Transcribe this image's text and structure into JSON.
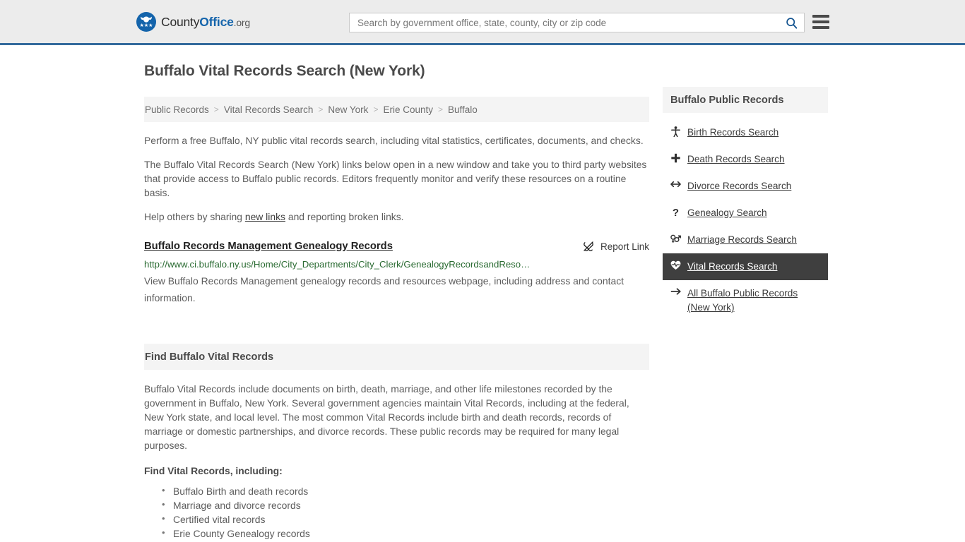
{
  "header": {
    "logo": {
      "part1": "County",
      "part2": "Office",
      "part3": ".org",
      "icon": "eagle-seal-icon"
    },
    "search": {
      "placeholder": "Search by government office, state, county, city or zip code",
      "value": "",
      "button_icon": "search-icon"
    },
    "menu_icon": "hamburger-menu-icon",
    "border_color": "#336a9c"
  },
  "main": {
    "title": "Buffalo Vital Records Search (New York)",
    "breadcrumb": {
      "separator": ">",
      "items": [
        "Public Records",
        "Vital Records Search",
        "New York",
        "Erie County",
        "Buffalo"
      ]
    },
    "paragraphs": [
      "Perform a free Buffalo, NY public vital records search, including vital statistics, certificates, documents, and checks.",
      "The Buffalo Vital Records Search (New York) links below open in a new window and take you to third party websites that provide access to Buffalo public records. Editors frequently monitor and verify these resources on a routine basis."
    ],
    "help_line": {
      "before": "Help others by sharing ",
      "link": "new links",
      "after": " and reporting broken links."
    },
    "result": {
      "title": "Buffalo Records Management Genealogy Records",
      "url": "http://www.ci.buffalo.ny.us/Home/City_Departments/City_Clerk/GenealogyRecordsandReso…",
      "url_color": "#2a6b32",
      "description": "View Buffalo Records Management genealogy records and resources webpage, including address and contact information.",
      "report": {
        "label": "Report Link",
        "icon": "broken-link-icon"
      }
    },
    "section": {
      "heading": "Find Buffalo Vital Records",
      "body": "Buffalo Vital Records include documents on birth, death, marriage, and other life milestones recorded by the government in Buffalo, New York. Several government agencies maintain Vital Records, including at the federal, New York state, and local level. The most common Vital Records include birth and death records, records of marriage or domestic partnerships, and divorce records. These public records may be required for many legal purposes.",
      "list_heading": "Find Vital Records, including:",
      "list": [
        "Buffalo Birth and death records",
        "Marriage and divorce records",
        "Certified vital records",
        "Erie County Genealogy records"
      ]
    }
  },
  "sidebar": {
    "heading": "Buffalo Public Records",
    "active_bg": "#3f3f3f",
    "items": [
      {
        "label": "Birth Records Search",
        "icon": "baby-icon",
        "glyph": "Ɣ",
        "active": false
      },
      {
        "label": "Death Records Search",
        "icon": "cross-icon",
        "glyph": "✚",
        "active": false
      },
      {
        "label": "Divorce Records Search",
        "icon": "split-arrows-icon",
        "glyph": "↔",
        "active": false
      },
      {
        "label": "Genealogy Search",
        "icon": "question-mark-icon",
        "glyph": "?",
        "active": false
      },
      {
        "label": "Marriage Records Search",
        "icon": "gender-symbols-icon",
        "glyph": "⚥",
        "active": false
      },
      {
        "label": "Vital Records Search",
        "icon": "heartbeat-icon",
        "glyph": "♥",
        "active": true
      },
      {
        "label": "All Buffalo Public Records (New York)",
        "icon": "arrow-right-icon",
        "glyph": "→",
        "active": false
      }
    ]
  }
}
